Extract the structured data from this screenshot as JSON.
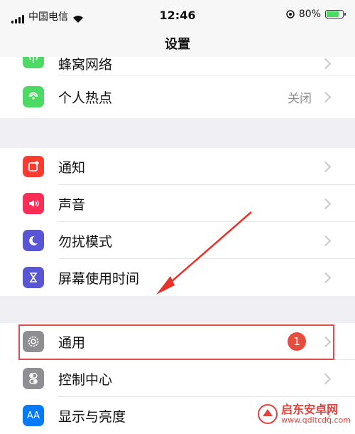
{
  "status": {
    "carrier": "中国电信",
    "time": "12:46",
    "battery": "80%",
    "battery_level": 0.8
  },
  "nav": {
    "title": "设置"
  },
  "groups": [
    {
      "items": [
        {
          "label": "蜂窝网络",
          "icon": "antenna-icon",
          "color": "#4cd964"
        },
        {
          "label": "个人热点",
          "icon": "hotspot-icon",
          "color": "#4cd964",
          "value": "关闭"
        }
      ]
    },
    {
      "items": [
        {
          "label": "通知",
          "icon": "notification-icon",
          "color": "#ff3b30"
        },
        {
          "label": "声音",
          "icon": "speaker-icon",
          "color": "#ff2d55"
        },
        {
          "label": "勿扰模式",
          "icon": "moon-icon",
          "color": "#5856d6"
        },
        {
          "label": "屏幕使用时间",
          "icon": "hourglass-icon",
          "color": "#5856d6"
        }
      ]
    },
    {
      "items": [
        {
          "label": "通用",
          "icon": "gear-icon",
          "color": "#8e8e93",
          "badge": "1"
        },
        {
          "label": "控制中心",
          "icon": "toggles-icon",
          "color": "#8e8e93"
        },
        {
          "label": "显示与亮度",
          "icon": "display-icon",
          "color": "#007aff",
          "icon_text": "AA"
        }
      ]
    }
  ],
  "watermark": {
    "title": "启东安卓网",
    "url": "www.qdltcdq.com"
  },
  "colors": {
    "highlight": "#e34c4c",
    "arrow": "#e8322a"
  }
}
